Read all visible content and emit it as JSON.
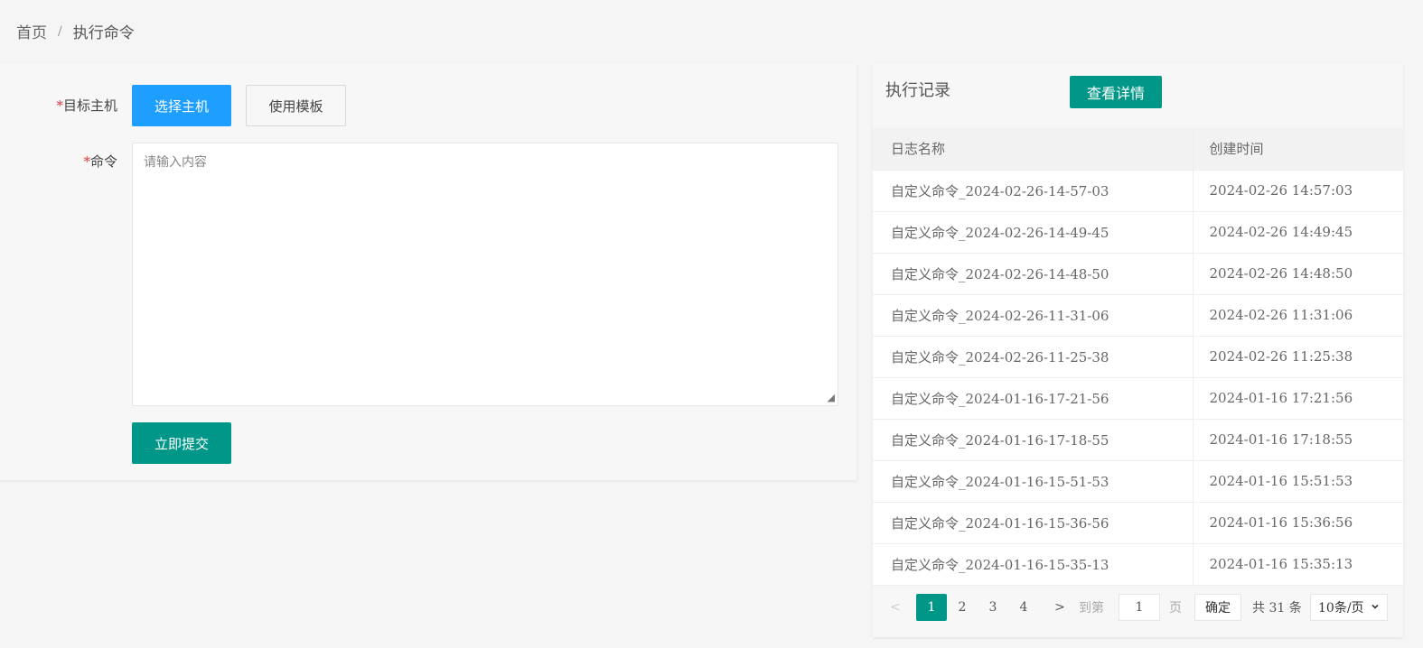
{
  "breadcrumb": {
    "home": "首页",
    "separator": "/",
    "current": "执行命令"
  },
  "form": {
    "target_label": "目标主机",
    "command_label": "命令",
    "required_mark": "*",
    "select_host_label": "选择主机",
    "use_template_label": "使用模板",
    "command_placeholder": "请输入内容",
    "submit_label": "立即提交"
  },
  "records": {
    "title": "执行记录",
    "details_label": "查看详情",
    "columns": [
      "日志名称",
      "创建时间"
    ],
    "rows": [
      {
        "name": "自定义命令_2024-02-26-14-57-03",
        "time": "2024-02-26 14:57:03"
      },
      {
        "name": "自定义命令_2024-02-26-14-49-45",
        "time": "2024-02-26 14:49:45"
      },
      {
        "name": "自定义命令_2024-02-26-14-48-50",
        "time": "2024-02-26 14:48:50"
      },
      {
        "name": "自定义命令_2024-02-26-11-31-06",
        "time": "2024-02-26 11:31:06"
      },
      {
        "name": "自定义命令_2024-02-26-11-25-38",
        "time": "2024-02-26 11:25:38"
      },
      {
        "name": "自定义命令_2024-01-16-17-21-56",
        "time": "2024-01-16 17:21:56"
      },
      {
        "name": "自定义命令_2024-01-16-17-18-55",
        "time": "2024-01-16 17:18:55"
      },
      {
        "name": "自定义命令_2024-01-16-15-51-53",
        "time": "2024-01-16 15:51:53"
      },
      {
        "name": "自定义命令_2024-01-16-15-36-56",
        "time": "2024-01-16 15:36:56"
      },
      {
        "name": "自定义命令_2024-01-16-15-35-13",
        "time": "2024-01-16 15:35:13"
      }
    ]
  },
  "pagination": {
    "prev": "<",
    "pages": [
      "1",
      "2",
      "3",
      "4"
    ],
    "current_page": "1",
    "next": ">",
    "goto_prefix": "到第",
    "goto_value": "1",
    "goto_suffix": "页",
    "confirm_label": "确定",
    "total_label": "共 31 条",
    "page_size": "10条/页",
    "page_size_icon": "chevron-down-icon"
  },
  "colors": {
    "primary_blue": "#1e9fff",
    "green": "#009688",
    "required_red": "#e0363a"
  }
}
